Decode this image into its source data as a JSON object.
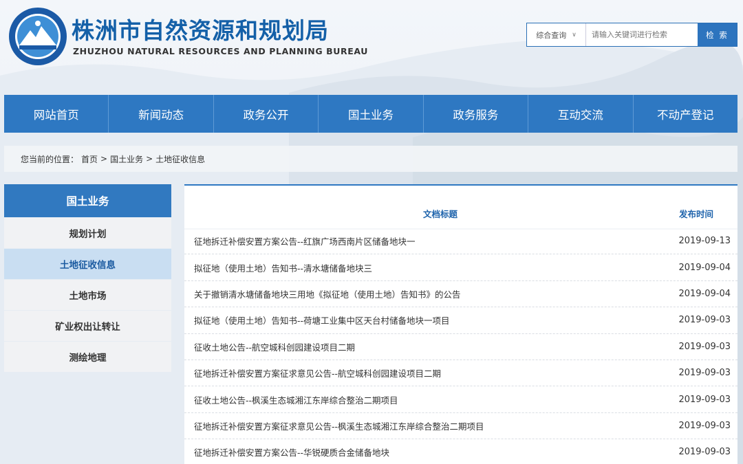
{
  "header": {
    "title": "株洲市自然资源和规划局",
    "subtitle": "ZHUZHOU NATURAL RESOURCES AND PLANNING BUREAU",
    "emblem_colors": [
      "#1b5aa6",
      "#ffffff",
      "#3e8fd6"
    ]
  },
  "search": {
    "scope_label": "综合查询",
    "placeholder": "请输入关键词进行检索",
    "button_label": "检 索"
  },
  "nav": {
    "items": [
      "网站首页",
      "新闻动态",
      "政务公开",
      "国土业务",
      "政务服务",
      "互动交流",
      "不动产登记"
    ]
  },
  "breadcrumb": {
    "prefix": "您当前的位置：",
    "items": [
      "首页",
      "国土业务",
      "土地征收信息"
    ],
    "separator": ">"
  },
  "sidebar": {
    "heading": "国土业务",
    "items": [
      "规划计划",
      "土地征收信息",
      "土地市场",
      "矿业权出让转让",
      "测绘地理"
    ],
    "active_index": 1
  },
  "table": {
    "col_title": "文档标题",
    "col_date": "发布时间",
    "rows": [
      {
        "title": "征地拆迁补偿安置方案公告--红旗广场西南片区储备地块一",
        "date": "2019-09-13"
      },
      {
        "title": "拟征地（使用土地）告知书--清水塘储备地块三",
        "date": "2019-09-04"
      },
      {
        "title": "关于撤销清水塘储备地块三用地《拟征地（使用土地）告知书》的公告",
        "date": "2019-09-04"
      },
      {
        "title": "拟征地（使用土地）告知书--荷塘工业集中区天台村储备地块一项目",
        "date": "2019-09-03"
      },
      {
        "title": "征收土地公告--航空城科创园建设项目二期",
        "date": "2019-09-03"
      },
      {
        "title": "征地拆迁补偿安置方案征求意见公告--航空城科创园建设项目二期",
        "date": "2019-09-03"
      },
      {
        "title": "征收土地公告--枫溪生态城湘江东岸综合整治二期项目",
        "date": "2019-09-03"
      },
      {
        "title": "征地拆迁补偿安置方案征求意见公告--枫溪生态城湘江东岸综合整治二期项目",
        "date": "2019-09-03"
      },
      {
        "title": "征地拆迁补偿安置方案公告--华锐硬质合金储备地块",
        "date": "2019-09-03"
      }
    ]
  },
  "colors": {
    "primary": "#2e78c2",
    "title_blue": "#1460a8",
    "active_bg": "#c9def2"
  }
}
